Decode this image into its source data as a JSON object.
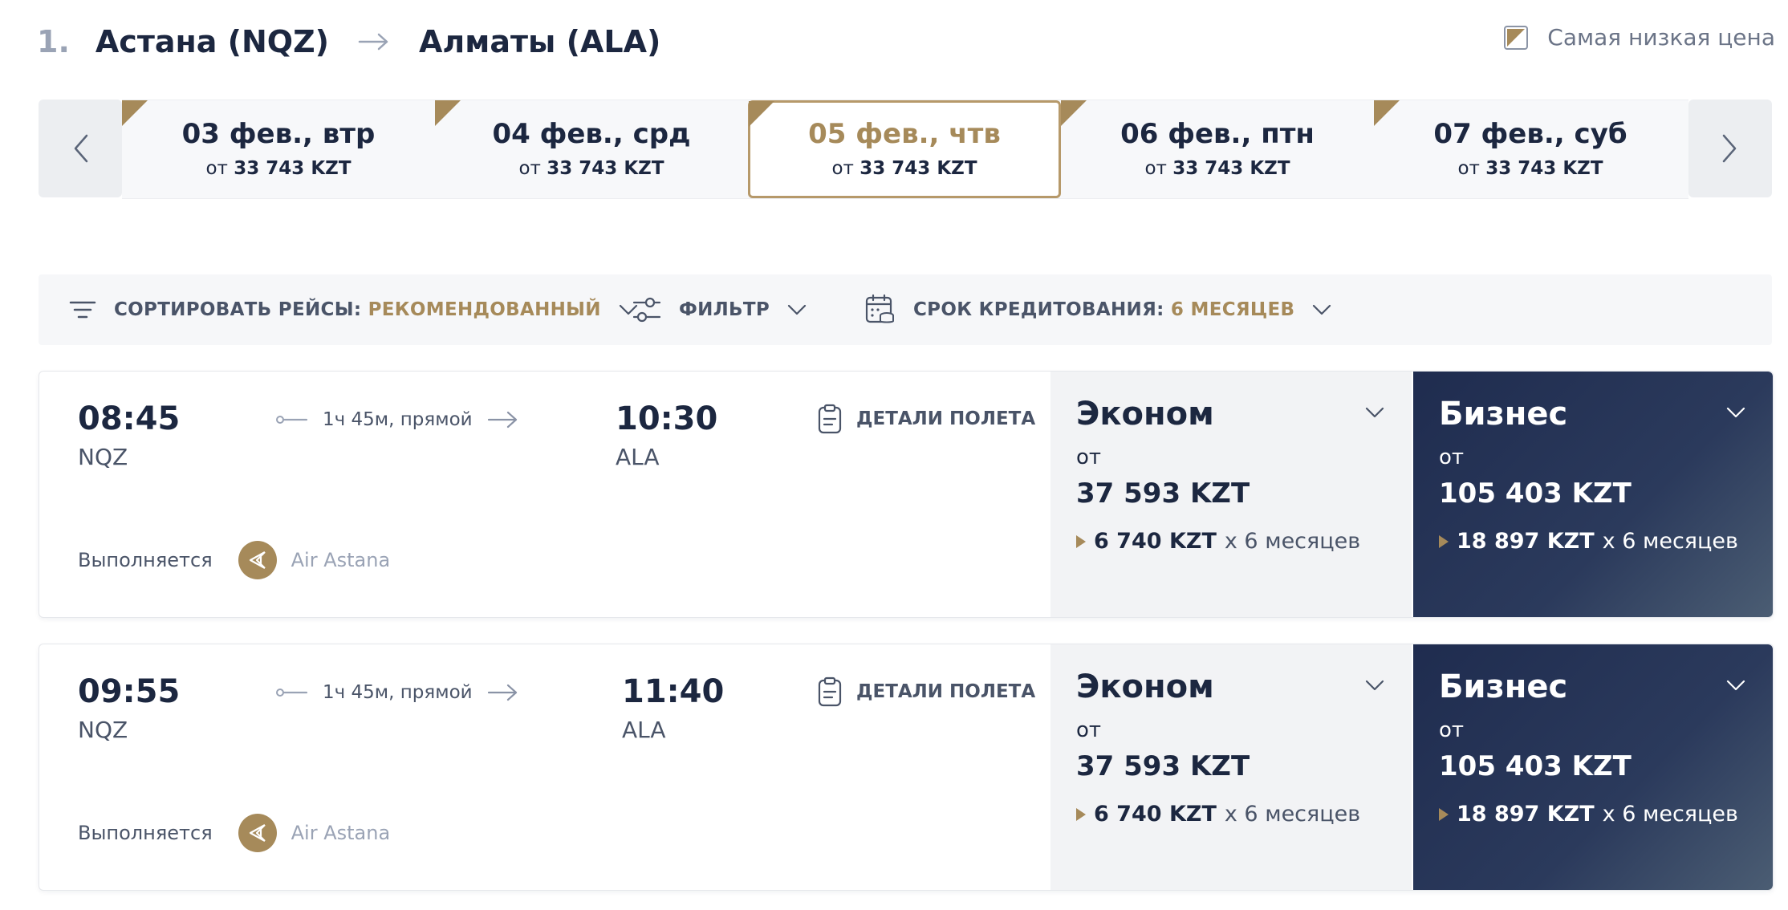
{
  "header": {
    "step_number": "1.",
    "origin": "Астана (NQZ)",
    "destination": "Алматы (ALA)",
    "lowest_price_label": "Самая низкая цена"
  },
  "dates": [
    {
      "label": "03 фев., втр",
      "price_prefix": "от",
      "price": "33 743 KZT",
      "active": false
    },
    {
      "label": "04 фев., срд",
      "price_prefix": "от",
      "price": "33 743 KZT",
      "active": false
    },
    {
      "label": "05 фев., чтв",
      "price_prefix": "от",
      "price": "33 743 KZT",
      "active": true
    },
    {
      "label": "06 фев., птн",
      "price_prefix": "от",
      "price": "33 743 KZT",
      "active": false
    },
    {
      "label": "07 фев., суб",
      "price_prefix": "от",
      "price": "33 743 KZT",
      "active": false
    }
  ],
  "toolbar": {
    "sort_label": "СОРТИРОВАТЬ РЕЙСЫ:",
    "sort_value": "РЕКОМЕНДОВАННЫЙ",
    "filter_label": "ФИЛЬТР",
    "credit_label": "СРОК КРЕДИТОВАНИЯ:",
    "credit_value": "6 МЕСЯЦЕВ"
  },
  "flights": [
    {
      "depart_time": "08:45",
      "depart_code": "NQZ",
      "duration": "1ч 45м, прямой",
      "arrive_time": "10:30",
      "arrive_code": "ALA",
      "details_label": "ДЕТАЛИ ПОЛЕТА",
      "operated_label": "Выполняется",
      "airline": "Air Astana",
      "economy": {
        "title": "Эконом",
        "from": "от",
        "price": "37 593 KZT",
        "installment": "6 740 KZT",
        "installment_suffix": "х 6 месяцев"
      },
      "business": {
        "title": "Бизнес",
        "from": "от",
        "price": "105 403 KZT",
        "installment": "18 897 KZT",
        "installment_suffix": "х 6 месяцев"
      }
    },
    {
      "depart_time": "09:55",
      "depart_code": "NQZ",
      "duration": "1ч 45м, прямой",
      "arrive_time": "11:40",
      "arrive_code": "ALA",
      "details_label": "ДЕТАЛИ ПОЛЕТА",
      "operated_label": "Выполняется",
      "airline": "Air Astana",
      "economy": {
        "title": "Эконом",
        "from": "от",
        "price": "37 593 KZT",
        "installment": "6 740 KZT",
        "installment_suffix": "х 6 месяцев"
      },
      "business": {
        "title": "Бизнес",
        "from": "от",
        "price": "105 403 KZT",
        "installment": "18 897 KZT",
        "installment_suffix": "х 6 месяцев"
      }
    }
  ],
  "colors": {
    "accent_gold": "#a68a5a",
    "navy": "#1c2740",
    "business_bg": "#1f2c4f"
  }
}
